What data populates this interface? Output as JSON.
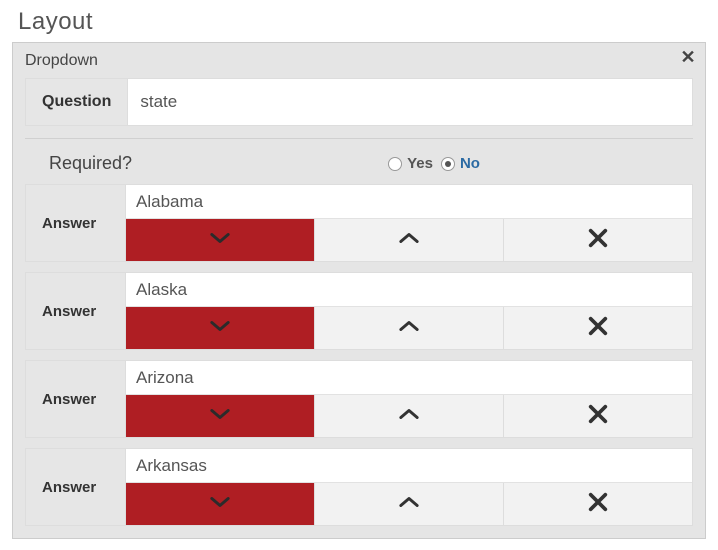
{
  "layout_title": "Layout",
  "panel": {
    "title": "Dropdown",
    "question_label": "Question",
    "question_value": "state",
    "required_label": "Required?",
    "required_options": {
      "yes": "Yes",
      "no": "No"
    },
    "required_selected": "No",
    "answer_label": "Answer",
    "answers": [
      "Alabama",
      "Alaska",
      "Arizona",
      "Arkansas"
    ]
  }
}
